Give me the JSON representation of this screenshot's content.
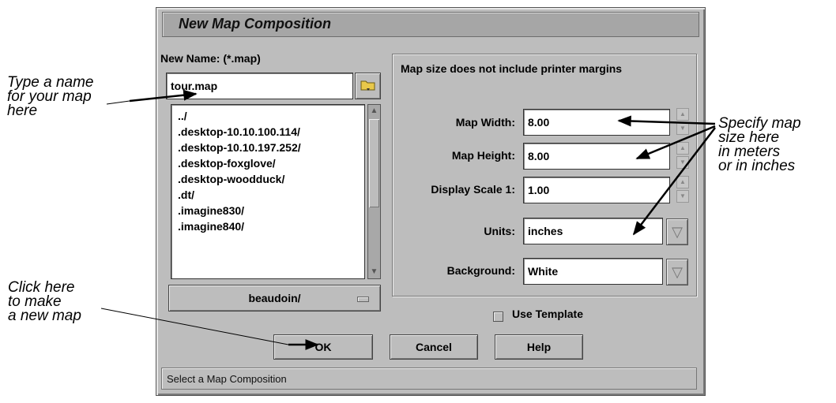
{
  "dialog": {
    "title": "New Map Composition",
    "new_name_label": "New Name: (*.map)",
    "name_value": "tour.map",
    "files": [
      "../",
      ".desktop-10.10.100.114/",
      ".desktop-10.10.197.252/",
      ".desktop-foxglove/",
      ".desktop-woodduck/",
      ".dt/",
      ".imagine830/",
      ".imagine840/"
    ],
    "directory": "beaudoin/",
    "margins_note": "Map size does not include printer margins",
    "map_width_label": "Map Width:",
    "map_width": "8.00",
    "map_height_label": "Map Height:",
    "map_height": "8.00",
    "display_scale_label": "Display Scale 1:",
    "display_scale": "1.00",
    "units_label": "Units:",
    "units": "inches",
    "background_label": "Background:",
    "background": "White",
    "use_template_label": "Use Template",
    "ok_label": "OK",
    "cancel_label": "Cancel",
    "help_label": "Help",
    "status": "Select a Map Composition"
  },
  "annotations": {
    "type_name": "Type a name\nfor your map\nhere",
    "click_here": "Click here\nto make\na new map",
    "specify_size": "Specify map\nsize here\nin meters\nor in inches"
  }
}
